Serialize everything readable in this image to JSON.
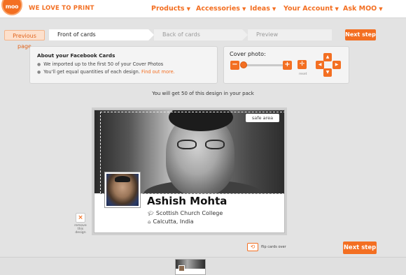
{
  "header": {
    "logo_text": "moo",
    "tagline": "WE LOVE TO PRINT",
    "nav": [
      {
        "label": "Products"
      },
      {
        "label": "Accessories"
      },
      {
        "label": "Ideas"
      },
      {
        "label": "Your Account"
      },
      {
        "label": "Ask MOO"
      }
    ],
    "caret": "▼"
  },
  "steps": {
    "previous_label": "Previous page",
    "items": [
      {
        "label": "Front of cards",
        "state": "active"
      },
      {
        "label": "Back of cards",
        "state": "inactive"
      },
      {
        "label": "Preview",
        "state": "inactive"
      }
    ],
    "next_label": "Next step"
  },
  "info_panel": {
    "title": "About your Facebook Cards",
    "bullet1": "We imported up to the first 50 of your Cover Photos",
    "bullet2_text": "You'll get equal quantities of each design.",
    "bullet2_link": "Find out more."
  },
  "cover_panel": {
    "title": "Cover photo:",
    "minus": "−",
    "plus": "+",
    "reset_label": "reset",
    "zoom_level": 0.05
  },
  "pack_text": "You will get 50 of this design in your pack",
  "card": {
    "safe_area_label": "safe area",
    "name": "Ashish Mohta",
    "school": "Scottish Church College",
    "location": "Calcutta, India"
  },
  "remove": {
    "icon": "×",
    "label_line1": "remove",
    "label_line2": "this",
    "label_line3": "design"
  },
  "flip": {
    "label": "flip cards over"
  },
  "bottom_next_label": "Next step",
  "colors": {
    "accent": "#f36f22",
    "background": "#e3e3e3"
  }
}
